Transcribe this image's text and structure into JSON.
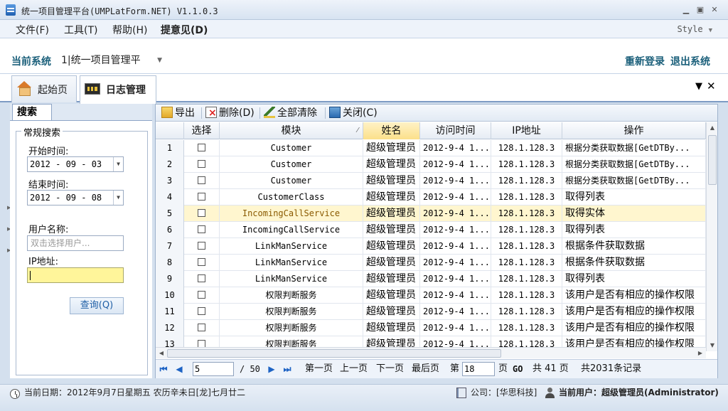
{
  "window": {
    "title": "统一项目管理平台(UMPLatForm.NET) V1.1.0.3"
  },
  "menu": {
    "items": [
      "文件(F)",
      "工具(T)",
      "帮助(H)",
      "提意见(D)"
    ],
    "style_label": "Style"
  },
  "system": {
    "label": "当前系统",
    "selected": "1|统一项目管理平",
    "relogin": "重新登录",
    "logout": "退出系统"
  },
  "tabs": [
    {
      "label": "起始页",
      "icon": "home-icon"
    },
    {
      "label": "日志管理",
      "icon": "log-monitor-icon"
    }
  ],
  "search": {
    "tab_label": "搜索",
    "group_label": "常规搜索",
    "start_label": "开始时间:",
    "start_value": "2012 - 09 - 03",
    "end_label": "结束时间:",
    "end_value": "2012 - 09 - 08",
    "user_label": "用户名称:",
    "user_placeholder": "双击选择用户...",
    "ip_label": "IP地址:",
    "ip_value": "",
    "query_label": "查询(Q)"
  },
  "toolbar": {
    "export": "导出",
    "delete": "删除(D)",
    "clear_all": "全部清除",
    "close": "关闭(C)"
  },
  "grid": {
    "columns": [
      "",
      "选择",
      "模块",
      "姓名",
      "访问时间",
      "IP地址",
      "操作"
    ],
    "selected_row": 4,
    "rows": [
      {
        "num": "1",
        "module": "Customer",
        "name": "超级管理员",
        "time": "2012-9-4 1...",
        "ip": "128.1.128.3",
        "op": "根据分类获取数据[GetDTBy..."
      },
      {
        "num": "2",
        "module": "Customer",
        "name": "超级管理员",
        "time": "2012-9-4 1...",
        "ip": "128.1.128.3",
        "op": "根据分类获取数据[GetDTBy..."
      },
      {
        "num": "3",
        "module": "Customer",
        "name": "超级管理员",
        "time": "2012-9-4 1...",
        "ip": "128.1.128.3",
        "op": "根据分类获取数据[GetDTBy..."
      },
      {
        "num": "4",
        "module": "CustomerClass",
        "name": "超级管理员",
        "time": "2012-9-4 1...",
        "ip": "128.1.128.3",
        "op": "取得列表"
      },
      {
        "num": "5",
        "module": "IncomingCallService",
        "name": "超级管理员",
        "time": "2012-9-4 1...",
        "ip": "128.1.128.3",
        "op": "取得实体"
      },
      {
        "num": "6",
        "module": "IncomingCallService",
        "name": "超级管理员",
        "time": "2012-9-4 1...",
        "ip": "128.1.128.3",
        "op": "取得列表"
      },
      {
        "num": "7",
        "module": "LinkManService",
        "name": "超级管理员",
        "time": "2012-9-4 1...",
        "ip": "128.1.128.3",
        "op": "根据条件获取数据"
      },
      {
        "num": "8",
        "module": "LinkManService",
        "name": "超级管理员",
        "time": "2012-9-4 1...",
        "ip": "128.1.128.3",
        "op": "根据条件获取数据"
      },
      {
        "num": "9",
        "module": "LinkManService",
        "name": "超级管理员",
        "time": "2012-9-4 1...",
        "ip": "128.1.128.3",
        "op": "取得列表"
      },
      {
        "num": "10",
        "module": "权限判断服务",
        "name": "超级管理员",
        "time": "2012-9-4 1...",
        "ip": "128.1.128.3",
        "op": "该用户是否有相应的操作权限"
      },
      {
        "num": "11",
        "module": "权限判断服务",
        "name": "超级管理员",
        "time": "2012-9-4 1...",
        "ip": "128.1.128.3",
        "op": "该用户是否有相应的操作权限"
      },
      {
        "num": "12",
        "module": "权限判断服务",
        "name": "超级管理员",
        "time": "2012-9-4 1...",
        "ip": "128.1.128.3",
        "op": "该用户是否有相应的操作权限"
      },
      {
        "num": "13",
        "module": "权限判断服务",
        "name": "超级管理员",
        "time": "2012-9-4 1...",
        "ip": "128.1.128.3",
        "op": "该用户是否有相应的操作权限"
      }
    ]
  },
  "pager": {
    "current_page": "5",
    "total_pages": "/ 50",
    "first": "第一页",
    "prev": "上一页",
    "next": "下一页",
    "last": "最后页",
    "goto_prefix": "第",
    "goto_value": "18",
    "goto_suffix": "页",
    "go": "GO",
    "total_pages_text": "共 41 页",
    "total_records": "共2031条记录"
  },
  "status": {
    "date": "当前日期：2012年9月7日星期五 农历辛未日[龙]七月廿二",
    "company": "公司：[华思科技]",
    "user": "当前用户：超级管理员(Administrator)"
  }
}
